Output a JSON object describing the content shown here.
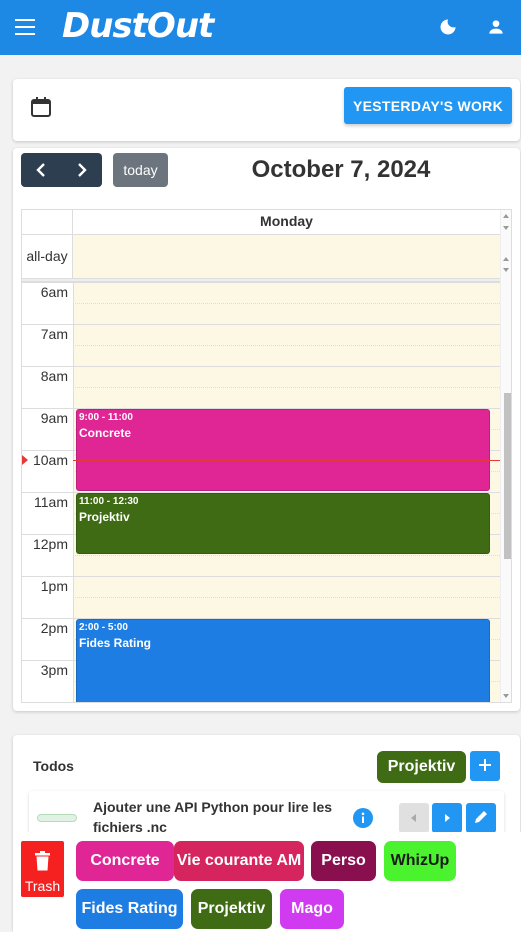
{
  "app": {
    "title": "DustOut"
  },
  "toolbar": {
    "yesterday_label": "YESTERDAY'S WORK"
  },
  "calendar": {
    "today_label": "today",
    "title": "October 7, 2024",
    "day_header": "Monday",
    "allday_label": "all-day",
    "times": [
      "6am",
      "7am",
      "8am",
      "9am",
      "10am",
      "11am",
      "12pm",
      "1pm",
      "2pm",
      "3pm"
    ],
    "events": [
      {
        "time": "9:00 - 11:00",
        "title": "Concrete",
        "color": "#e02595"
      },
      {
        "time": "11:00 - 12:30",
        "title": "Projektiv",
        "color": "#3e6b13"
      },
      {
        "time": "2:00 - 5:00",
        "title": "Fides Rating",
        "color": "#1e7de3"
      }
    ],
    "background_color": "#fcf8e3"
  },
  "todos": {
    "title": "Todos",
    "project_chip": "Projektiv",
    "items": [
      {
        "text": "Ajouter une API Python pour lire les fichiers .nc"
      }
    ]
  },
  "categories": {
    "trash_label": "Trash",
    "items": [
      {
        "label": "Concrete",
        "color": "#e02595",
        "text_color": "#ffffff"
      },
      {
        "label": "Vie courante AM",
        "color": "#d6245f",
        "text_color": "#ffffff"
      },
      {
        "label": "Perso",
        "color": "#8a0f4f",
        "text_color": "#ffffff"
      },
      {
        "label": "WhizUp",
        "color": "#4bf22e",
        "text_color": "#1a1a1a"
      },
      {
        "label": "Fides Rating",
        "color": "#1e7de3",
        "text_color": "#ffffff"
      },
      {
        "label": "Projektiv",
        "color": "#3e6b13",
        "text_color": "#ffffff"
      },
      {
        "label": "Mago",
        "color": "#d03bf2",
        "text_color": "#ffffff"
      }
    ]
  },
  "colors": {
    "appbar": "#1e88e5",
    "accent": "#2196f3",
    "now_indicator": "#e53935"
  },
  "icons": [
    "menu-icon",
    "moon-icon",
    "user-icon",
    "calendar-icon",
    "chevron-left-icon",
    "chevron-right-icon",
    "plus-icon",
    "info-icon",
    "pencil-icon",
    "trash-icon"
  ]
}
